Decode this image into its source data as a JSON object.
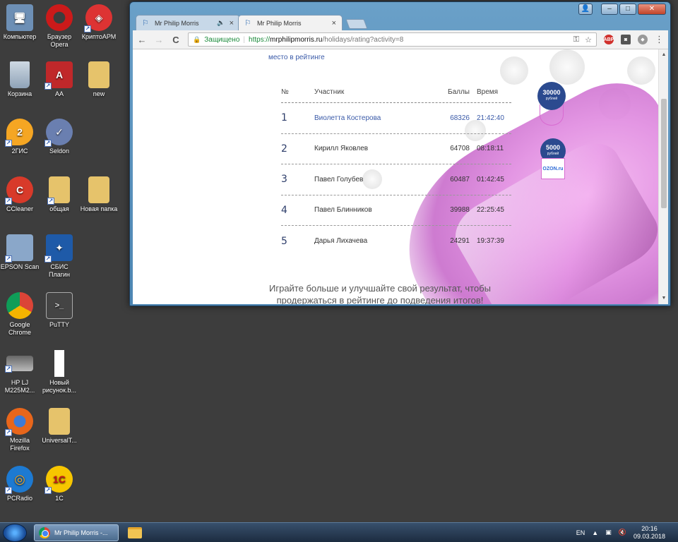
{
  "desktop": {
    "icons": [
      {
        "label": "Компьютер",
        "icon": "computer-icon",
        "color": "#6d8fb5"
      },
      {
        "label": "Браузер Opera",
        "icon": "opera-icon",
        "color": "#cc1a1a"
      },
      {
        "label": "КриптоАРМ",
        "icon": "cryptoarm-icon",
        "color": "#d33"
      },
      {
        "label": "Корзина",
        "icon": "recycle-bin-icon",
        "color": "#9fb3c8"
      },
      {
        "label": "AA",
        "icon": "aa-icon",
        "color": "#c0282a"
      },
      {
        "label": "new",
        "icon": "folder-icon",
        "color": "#e6c36b"
      },
      {
        "label": "2ГИС",
        "icon": "2gis-icon",
        "color": "#f5a623"
      },
      {
        "label": "Seldon",
        "icon": "seldon-icon",
        "color": "#6a7fb0"
      },
      {
        "label": "CCleaner",
        "icon": "ccleaner-icon",
        "color": "#d83a2a"
      },
      {
        "label": "общая",
        "icon": "shared-folder-icon",
        "color": "#e6c36b"
      },
      {
        "label": "Новая папка",
        "icon": "folder-icon",
        "color": "#e6c36b"
      },
      {
        "label": "EPSON Scan",
        "icon": "scanner-icon",
        "color": "#8aa7c9"
      },
      {
        "label": "СБИС Плагин",
        "icon": "sbis-icon",
        "color": "#1e5aa8"
      },
      {
        "label": "Google Chrome",
        "icon": "chrome-icon",
        "color": "#4285f4"
      },
      {
        "label": "PuTTY",
        "icon": "putty-icon",
        "color": "#444"
      },
      {
        "label": "HP LJ M225M2...",
        "icon": "printer-icon",
        "color": "#bbb"
      },
      {
        "label": "Новый рисунок.b...",
        "icon": "bitmap-icon",
        "color": "#fff"
      },
      {
        "label": "Mozilla Firefox",
        "icon": "firefox-icon",
        "color": "#e8661b"
      },
      {
        "label": "UniversalT...",
        "icon": "folder-icon",
        "color": "#e6c36b"
      },
      {
        "label": "PCRadio",
        "icon": "pcradio-icon",
        "color": "#1d7ad2"
      },
      {
        "label": "1C",
        "icon": "1c-icon",
        "color": "#f7c600"
      }
    ]
  },
  "browser": {
    "tabs": [
      {
        "title": "Mr Philip Morris",
        "audio_icon": "speaker-icon",
        "close": "×"
      },
      {
        "title": "Mr Philip Morris",
        "close": "×"
      }
    ],
    "window_buttons": {
      "minimize": "–",
      "maximize": "□",
      "close": "✕"
    },
    "nav": {
      "back": "←",
      "forward": "→",
      "reload": "C"
    },
    "address": {
      "secure_label": "Защищено",
      "scheme": "https://",
      "host": "mrphilipmorris.ru",
      "path": "/holidays/rating?activity=8"
    },
    "extensions": [
      {
        "name": "abp-icon",
        "label": "ABP",
        "color": "#d0312d"
      },
      {
        "name": "camera-icon",
        "label": "◙",
        "color": "#555"
      },
      {
        "name": "extension-icon",
        "label": "◆",
        "color": "#999"
      }
    ],
    "menu": "⋮"
  },
  "page": {
    "rank_link": "место в рейтинге",
    "table": {
      "headers": {
        "num": "№",
        "participant": "Участник",
        "score": "Баллы",
        "time": "Время"
      },
      "rows": [
        {
          "num": "1",
          "name": "Виолетта Костерова",
          "score": "68326",
          "time": "21:42:40"
        },
        {
          "num": "2",
          "name": "Кирилл Яковлев",
          "score": "64708",
          "time": "08:18:11"
        },
        {
          "num": "3",
          "name": "Павел Голубев",
          "score": "60487",
          "time": "01:42:45"
        },
        {
          "num": "4",
          "name": "Павел Блинников",
          "score": "39988",
          "time": "22:25:45"
        },
        {
          "num": "5",
          "name": "Дарья Лихачева",
          "score": "24291",
          "time": "19:37:39"
        }
      ]
    },
    "bottom_text_line1": "Играйте больше и улучшайте свой результат, чтобы",
    "bottom_text_line2": "продержаться в рейтинге до подведения итогов!",
    "prizes": [
      {
        "amount": "30000",
        "unit": "рублей",
        "item_icon": "necklace-icon"
      },
      {
        "amount": "5000",
        "unit": "рублей",
        "item_icon": "ozon-icon",
        "item_label": "OZON.ru"
      }
    ],
    "accent_color": "#2b4a8f"
  },
  "taskbar": {
    "task_label": "Mr Philip Morris -...",
    "lang": "EN",
    "time": "20:16",
    "date": "09.03.2018"
  }
}
